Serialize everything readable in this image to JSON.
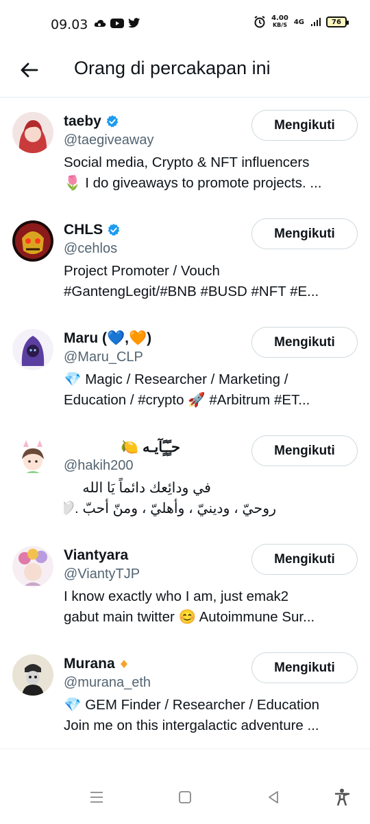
{
  "status_bar": {
    "time": "09.03",
    "speed_top": "4.00",
    "speed_unit": "KB/S",
    "network": "4G",
    "battery": "76"
  },
  "header": {
    "title": "Orang di percakapan ini"
  },
  "users": [
    {
      "name": "taeby",
      "handle": "@taegiveaway",
      "verified": "blue",
      "bio": [
        "Social media, Crypto & NFT influencers",
        "🌷 I do giveaways to promote projects. ..."
      ],
      "follow_label": "Mengikuti"
    },
    {
      "name": "CHLS",
      "handle": "@cehlos",
      "verified": "blue",
      "bio": [
        "Project Promoter / Vouch",
        "#GantengLegit/#BNB #BUSD #NFT #E..."
      ],
      "follow_label": "Mengikuti"
    },
    {
      "name": "Maru (💙,🧡)",
      "handle": "@Maru_CLP",
      "verified": "none",
      "bio": [
        "💎 Magic / Researcher / Marketing /",
        "Education / #crypto 🚀 #Arbitrum #ET..."
      ],
      "follow_label": "Mengikuti"
    },
    {
      "name": "حـًٍـًٍآيـه 🍋",
      "handle": "@hakih200",
      "verified": "none",
      "bio": [
        "في ودائِعك دائماً يَا الله",
        "روحيّ ، ودينيّ ، وأهليّ ، ومنّ أحبّ .🤍"
      ],
      "follow_label": "Mengikuti"
    },
    {
      "name": "Viantyara",
      "handle": "@ViantyTJP",
      "verified": "none",
      "bio": [
        "I know exactly who I am, just emak2",
        "gabut main twitter 😊 Autoimmune Sur..."
      ],
      "follow_label": "Mengikuti"
    },
    {
      "name": "Murana",
      "handle": "@murana_eth",
      "verified": "orange-diamond",
      "bio": [
        "💎 GEM Finder / Researcher / Education",
        "Join me on this intergalactic adventure ..."
      ],
      "follow_label": "Mengikuti"
    }
  ],
  "colors": {
    "verified": "#1d9bf0",
    "handle": "#536471",
    "button_border": "#cfd9de",
    "diamond": "#f7a32b"
  }
}
